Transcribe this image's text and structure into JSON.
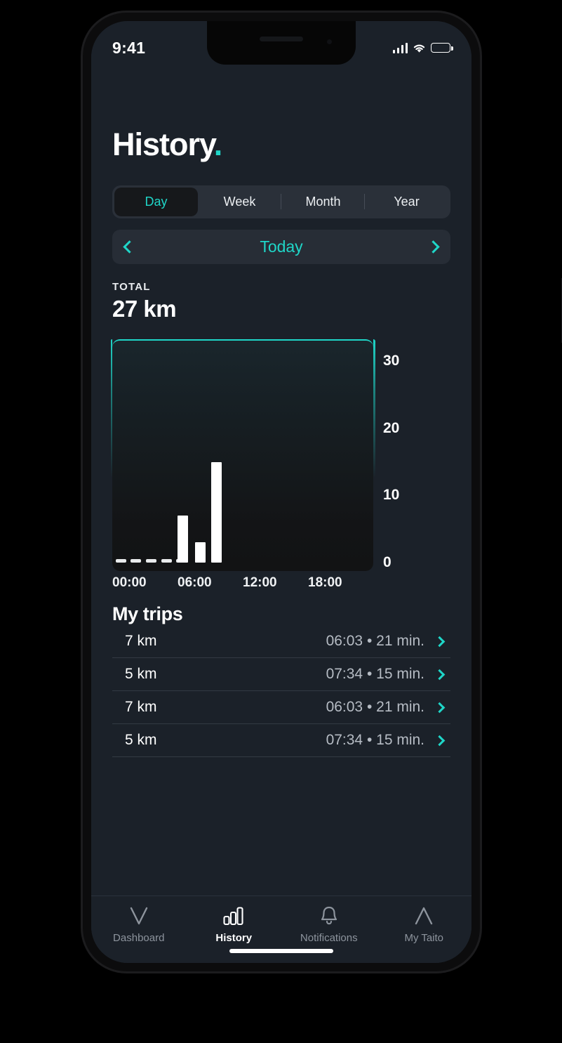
{
  "status_bar": {
    "time": "9:41",
    "signal_icon": "cellular-bars-icon",
    "wifi_icon": "wifi-icon",
    "battery_icon": "battery-full-icon"
  },
  "header": {
    "title": "History",
    "title_dot": "."
  },
  "period_tabs": {
    "selected": "Day",
    "items": [
      {
        "label": "Day",
        "active": true
      },
      {
        "label": "Week",
        "active": false
      },
      {
        "label": "Month",
        "active": false
      },
      {
        "label": "Year",
        "active": false
      }
    ]
  },
  "date_nav": {
    "prev_icon": "chevron-left-icon",
    "label": "Today",
    "next_icon": "chevron-right-icon"
  },
  "total": {
    "label": "TOTAL",
    "value": "27 km"
  },
  "chart_data": {
    "type": "bar",
    "title": "",
    "xlabel": "",
    "ylabel": "",
    "x_tick_labels": [
      "00:00",
      "06:00",
      "12:00",
      "18:00"
    ],
    "y_tick_labels": [
      "0",
      "10",
      "20",
      "30"
    ],
    "ylim": [
      0,
      32
    ],
    "xlim": [
      0,
      24
    ],
    "grid": false,
    "legend": false,
    "bar_color": "#ffffff",
    "accent_color": "#1fd6c8",
    "x": [
      6.0,
      7.6,
      9.1
    ],
    "values": [
      7,
      3,
      15
    ],
    "zero_markers_x": [
      0.3,
      1.7,
      3.1,
      4.5,
      5.9
    ],
    "zero_marker_value": 0
  },
  "trips": {
    "title": "My trips",
    "rows": [
      {
        "distance": "7 km",
        "meta": "06:03 • 21 min.",
        "chevron": "chevron-right-icon"
      },
      {
        "distance": "5 km",
        "meta": "07:34 • 15 min.",
        "chevron": "chevron-right-icon"
      },
      {
        "distance": "7 km",
        "meta": "06:03 • 21 min.",
        "chevron": "chevron-right-icon"
      },
      {
        "distance": "5 km",
        "meta": "07:34 • 15 min.",
        "chevron": "chevron-right-icon"
      }
    ]
  },
  "tab_bar": {
    "items": [
      {
        "label": "Dashboard",
        "icon": "v-chart-icon",
        "active": false
      },
      {
        "label": "History",
        "icon": "bar-chart-icon",
        "active": true
      },
      {
        "label": "Notifications",
        "icon": "bell-icon",
        "active": false
      },
      {
        "label": "My Taito",
        "icon": "caret-up-icon",
        "active": false
      }
    ]
  },
  "colors": {
    "accent": "#1fd6c8",
    "screen_bg": "#1b2129",
    "panel_bg": "#272d36",
    "text_primary": "#ffffff",
    "text_muted": "#b6bcc4"
  }
}
